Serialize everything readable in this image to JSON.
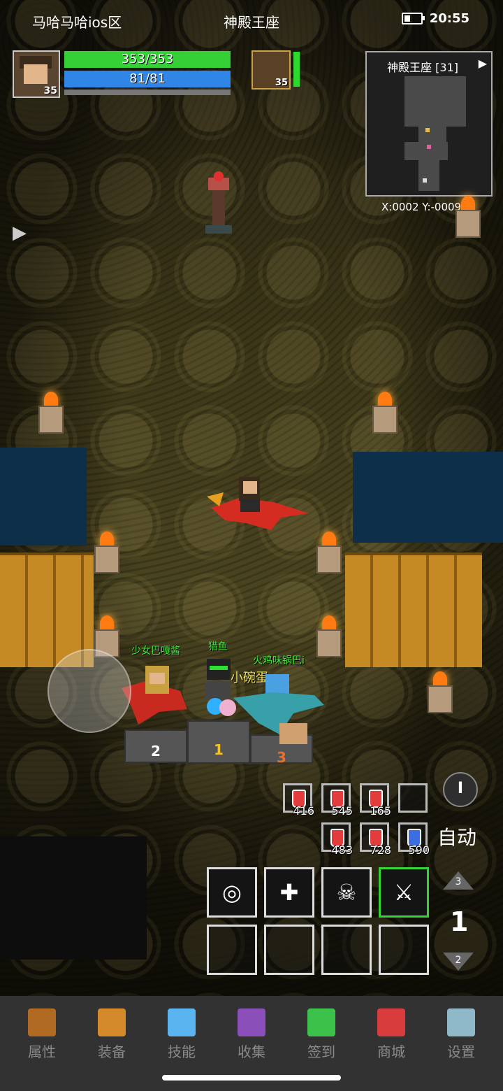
{
  "status": {
    "server": "马哈马哈ios区",
    "location": "神殿王座",
    "time": "20:55"
  },
  "player": {
    "level": "35",
    "hp": "353/353",
    "mp": "81/81"
  },
  "pet": {
    "level": "35",
    "hp_fraction": 1.0
  },
  "minimap": {
    "title": "神殿王座 [31]",
    "arrow": "▶",
    "coords": "X:0002  Y:-0009"
  },
  "names": {
    "main": "小碗蛋",
    "left": "少女巴嘎酱",
    "mid": "猎鱼",
    "right": "火鸡味锅巴i"
  },
  "podium": {
    "first": "1",
    "second": "2",
    "third": "3"
  },
  "potions": [
    {
      "count": "416",
      "color": "red"
    },
    {
      "count": "545",
      "color": "red"
    },
    {
      "count": "165",
      "color": "red"
    },
    {
      "count": "483",
      "color": "red"
    },
    {
      "count": "728",
      "color": "red"
    },
    {
      "count": "590",
      "color": "blue"
    }
  ],
  "skills": {
    "icons": [
      "◎",
      "✚",
      "☠",
      "⚔"
    ]
  },
  "controls": {
    "round_btn": "I",
    "auto": "自动",
    "page_up": "3",
    "page": "1",
    "page_down": "2",
    "side_arrow": "▶"
  },
  "nav": [
    {
      "label": "属性",
      "icon": "helmet-icon",
      "color": "#b06a22"
    },
    {
      "label": "装备",
      "icon": "bag-icon",
      "color": "#d48a2a"
    },
    {
      "label": "技能",
      "icon": "crystal-icon",
      "color": "#5ab4f0"
    },
    {
      "label": "收集",
      "icon": "book-icon",
      "color": "#8a4fb8"
    },
    {
      "label": "签到",
      "icon": "gem-icon",
      "color": "#3cc24a"
    },
    {
      "label": "商城",
      "icon": "shop-icon",
      "color": "#d83c3c"
    },
    {
      "label": "设置",
      "icon": "gear-icon",
      "color": "#8fb8c8"
    }
  ]
}
